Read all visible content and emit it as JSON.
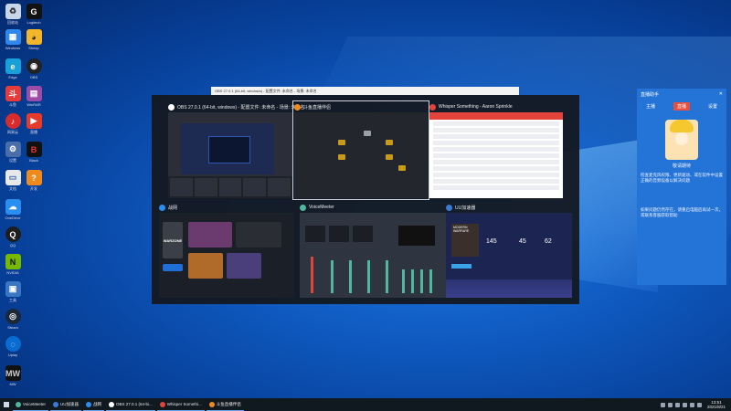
{
  "desktop": {
    "icons": [
      {
        "label": "回收站"
      },
      {
        "label": "Logitech"
      },
      {
        "label": "Windows"
      },
      {
        "label": "Sheep"
      },
      {
        "label": "Edge"
      },
      {
        "label": "OBS"
      },
      {
        "label": "斗鱼"
      },
      {
        "label": "WinRAR"
      },
      {
        "label": "网易云"
      },
      {
        "label": "直播"
      },
      {
        "label": "设置"
      },
      {
        "label": "Black"
      },
      {
        "label": "文档"
      },
      {
        "label": "开发"
      },
      {
        "label": "OneDrive"
      },
      {
        "label": "QQ"
      },
      {
        "label": "NVIDIA"
      },
      {
        "label": "工具"
      },
      {
        "label": "Steam"
      },
      {
        "label": "Uplay"
      },
      {
        "label": "MW"
      }
    ]
  },
  "dialog": {
    "title": "OBS 27.0.1 (64-bit, windows) - 配置文件: 未命名 - 场景: 未命名"
  },
  "taskview": {
    "windows": [
      {
        "title": "OBS 27.0.1 (64-bit, windows) - 配置文件: 未命名 - 场景: 未命名"
      },
      {
        "title": "斗鱼直播伴侣"
      },
      {
        "title": "Whisper Something - Aaron Sprinkle"
      },
      {
        "title": "战网"
      },
      {
        "title": "VoiceMeeter"
      },
      {
        "title": "UU加速器"
      }
    ],
    "game_title": "WARZONE",
    "dashboard_title": "MODERN WARFARE",
    "dashboard_stat1": "145",
    "dashboard_stat2": "45",
    "dashboard_stat3": "62"
  },
  "notice": {
    "title": "直播助手",
    "tabs": [
      "主播",
      "直播",
      "设置"
    ],
    "art_caption": "敬请期待",
    "text1": "检查麦克风权限、更新驱动、或在软件中设置正确的音频设备以解决问题",
    "text2": "如果问题仍然存在，请重启电脑后再试一次，或联系客服获取帮助"
  },
  "taskbar": {
    "items": [
      {
        "label": "VoiceMeeter",
        "color": "#4fb79e"
      },
      {
        "label": "UU加速器",
        "color": "#3a7bd5"
      },
      {
        "label": "战网",
        "color": "#2a8ef0"
      },
      {
        "label": "OBS 27.0.1 (64-bi...",
        "color": "#ffffff"
      },
      {
        "label": "Whisper Somethi...",
        "color": "#e2433b"
      },
      {
        "label": "斗鱼直播伴侣",
        "color": "#f28b1e"
      }
    ],
    "time": "13:51",
    "date": "2021/8/21"
  }
}
